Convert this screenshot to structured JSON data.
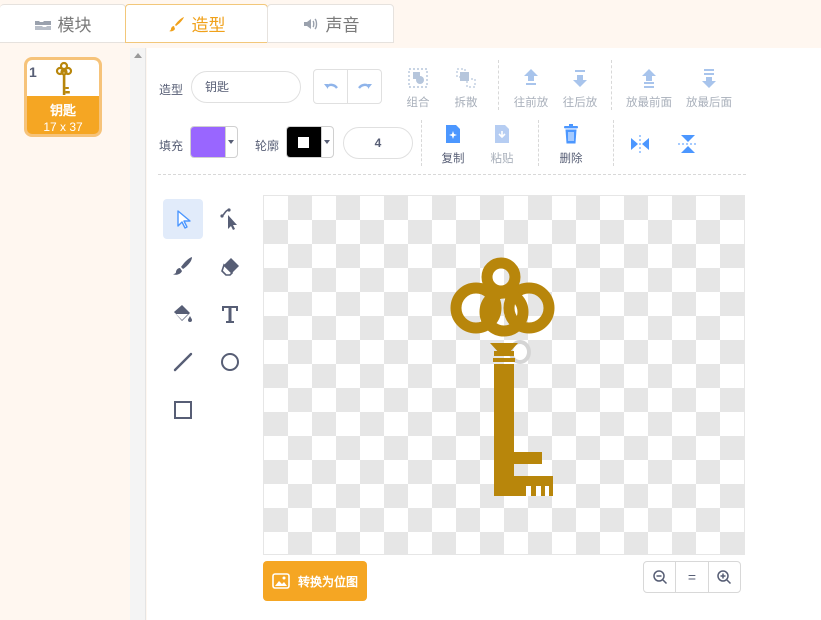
{
  "tabs": {
    "blocks": "模块",
    "costumes": "造型",
    "sounds": "声音"
  },
  "costume_list": {
    "items": [
      {
        "index": "1",
        "name": "钥匙",
        "size": "17 x 37"
      }
    ]
  },
  "toolbar": {
    "costume_label": "造型",
    "costume_name": "钥匙",
    "group": "组合",
    "ungroup": "拆散",
    "forward": "往前放",
    "backward": "往后放",
    "front": "放最前面",
    "back": "放最后面",
    "fill_label": "填充",
    "outline_label": "轮廓",
    "stroke_width": "4",
    "copy": "复制",
    "paste": "粘贴",
    "delete": "删除"
  },
  "colors": {
    "accent": "#f5a623",
    "fill": "#9966ff",
    "outline": "#000000",
    "key": "#b8860b",
    "selected_tool": "#e1ebfa"
  },
  "tools": [
    "select-icon",
    "reshape-icon",
    "brush-icon",
    "eraser-icon",
    "fill-icon",
    "text-icon",
    "line-icon",
    "circle-icon",
    "rectangle-icon"
  ],
  "bottom": {
    "convert_bitmap": "转换为位图",
    "zoom_reset": "="
  }
}
